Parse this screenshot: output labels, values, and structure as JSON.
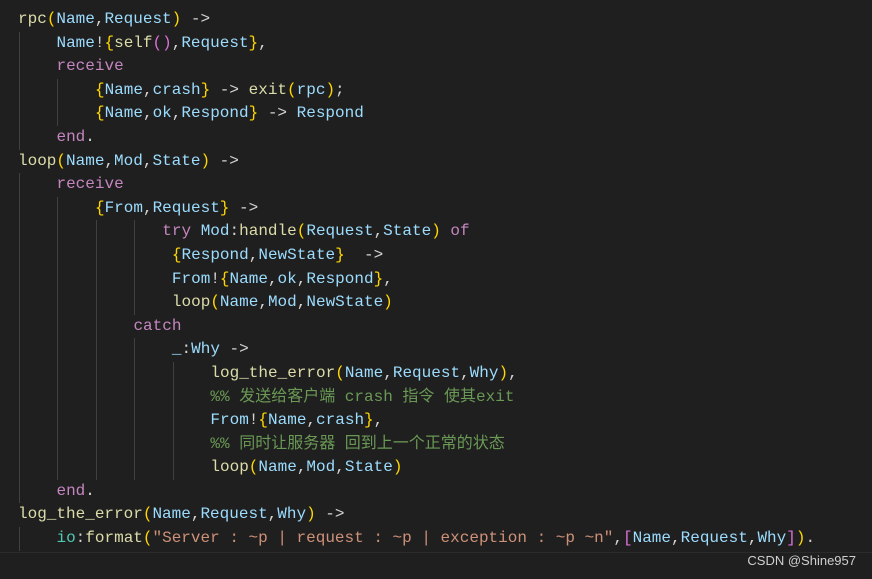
{
  "editor": {
    "background": "#1f1f1f",
    "lines": [
      {
        "indent": 0,
        "tokens": [
          [
            "rpc",
            "f"
          ],
          [
            "(",
            "b1"
          ],
          [
            "Name",
            "v"
          ],
          [
            ",",
            "p"
          ],
          [
            "Request",
            "v"
          ],
          [
            ")",
            "b1"
          ],
          [
            " ->",
            "p"
          ]
        ]
      },
      {
        "indent": 4,
        "tokens": [
          [
            "Name",
            "v"
          ],
          [
            "!",
            "p"
          ],
          [
            "{",
            "b1"
          ],
          [
            "self",
            "f"
          ],
          [
            "(",
            "b2"
          ],
          [
            ")",
            "b2"
          ],
          [
            ",",
            "p"
          ],
          [
            "Request",
            "v"
          ],
          [
            "}",
            "b1"
          ],
          [
            ",",
            "p"
          ]
        ]
      },
      {
        "indent": 4,
        "tokens": [
          [
            "receive",
            "k"
          ]
        ]
      },
      {
        "indent": 8,
        "tokens": [
          [
            "{",
            "b1"
          ],
          [
            "Name",
            "v"
          ],
          [
            ",",
            "p"
          ],
          [
            "crash",
            "v"
          ],
          [
            "}",
            "b1"
          ],
          [
            " -> ",
            "p"
          ],
          [
            "exit",
            "f"
          ],
          [
            "(",
            "b1"
          ],
          [
            "rpc",
            "v"
          ],
          [
            ")",
            "b1"
          ],
          [
            ";",
            "p"
          ]
        ]
      },
      {
        "indent": 8,
        "tokens": [
          [
            "{",
            "b1"
          ],
          [
            "Name",
            "v"
          ],
          [
            ",",
            "p"
          ],
          [
            "ok",
            "v"
          ],
          [
            ",",
            "p"
          ],
          [
            "Respond",
            "v"
          ],
          [
            "}",
            "b1"
          ],
          [
            " -> ",
            "p"
          ],
          [
            "Respond",
            "v"
          ]
        ]
      },
      {
        "indent": 4,
        "tokens": [
          [
            "end",
            "k"
          ],
          [
            ".",
            "p"
          ]
        ]
      },
      {
        "indent": 0,
        "tokens": [
          [
            "loop",
            "f"
          ],
          [
            "(",
            "b1"
          ],
          [
            "Name",
            "v"
          ],
          [
            ",",
            "p"
          ],
          [
            "Mod",
            "v"
          ],
          [
            ",",
            "p"
          ],
          [
            "State",
            "v"
          ],
          [
            ")",
            "b1"
          ],
          [
            " ->",
            "p"
          ]
        ]
      },
      {
        "indent": 4,
        "tokens": [
          [
            "receive",
            "k"
          ]
        ]
      },
      {
        "indent": 8,
        "tokens": [
          [
            "{",
            "b1"
          ],
          [
            "From",
            "v"
          ],
          [
            ",",
            "p"
          ],
          [
            "Request",
            "v"
          ],
          [
            "}",
            "b1"
          ],
          [
            " ->",
            "p"
          ]
        ]
      },
      {
        "indent": 15,
        "tokens": [
          [
            "try ",
            "k"
          ],
          [
            "Mod",
            "v"
          ],
          [
            ":",
            "p"
          ],
          [
            "handle",
            "f"
          ],
          [
            "(",
            "b1"
          ],
          [
            "Request",
            "v"
          ],
          [
            ",",
            "p"
          ],
          [
            "State",
            "v"
          ],
          [
            ")",
            "b1"
          ],
          [
            " of",
            "k"
          ]
        ]
      },
      {
        "indent": 16,
        "tokens": [
          [
            "{",
            "b1"
          ],
          [
            "Respond",
            "v"
          ],
          [
            ",",
            "p"
          ],
          [
            "NewState",
            "v"
          ],
          [
            "}",
            "b1"
          ],
          [
            "  ->",
            "p"
          ]
        ]
      },
      {
        "indent": 16,
        "tokens": [
          [
            "From",
            "v"
          ],
          [
            "!",
            "p"
          ],
          [
            "{",
            "b1"
          ],
          [
            "Name",
            "v"
          ],
          [
            ",",
            "p"
          ],
          [
            "ok",
            "v"
          ],
          [
            ",",
            "p"
          ],
          [
            "Respond",
            "v"
          ],
          [
            "}",
            "b1"
          ],
          [
            ",",
            "p"
          ]
        ]
      },
      {
        "indent": 16,
        "tokens": [
          [
            "loop",
            "f"
          ],
          [
            "(",
            "b1"
          ],
          [
            "Name",
            "v"
          ],
          [
            ",",
            "p"
          ],
          [
            "Mod",
            "v"
          ],
          [
            ",",
            "p"
          ],
          [
            "NewState",
            "v"
          ],
          [
            ")",
            "b1"
          ]
        ]
      },
      {
        "indent": 12,
        "tokens": [
          [
            "catch",
            "k"
          ]
        ]
      },
      {
        "indent": 16,
        "tokens": [
          [
            "_",
            "v"
          ],
          [
            ":",
            "p"
          ],
          [
            "Why",
            "v"
          ],
          [
            " ->",
            "p"
          ]
        ]
      },
      {
        "indent": 20,
        "tokens": [
          [
            "log_the_error",
            "f"
          ],
          [
            "(",
            "b1"
          ],
          [
            "Name",
            "v"
          ],
          [
            ",",
            "p"
          ],
          [
            "Request",
            "v"
          ],
          [
            ",",
            "p"
          ],
          [
            "Why",
            "v"
          ],
          [
            ")",
            "b1"
          ],
          [
            ",",
            "p"
          ]
        ]
      },
      {
        "indent": 20,
        "tokens": [
          [
            "%% 发送给客户端 crash 指令 使其exit",
            "c"
          ]
        ]
      },
      {
        "indent": 20,
        "tokens": [
          [
            "From",
            "v"
          ],
          [
            "!",
            "p"
          ],
          [
            "{",
            "b1"
          ],
          [
            "Name",
            "v"
          ],
          [
            ",",
            "p"
          ],
          [
            "crash",
            "v"
          ],
          [
            "}",
            "b1"
          ],
          [
            ",",
            "p"
          ]
        ]
      },
      {
        "indent": 20,
        "tokens": [
          [
            "%% 同时让服务器 回到上一个正常的状态",
            "c"
          ]
        ]
      },
      {
        "indent": 20,
        "tokens": [
          [
            "loop",
            "f"
          ],
          [
            "(",
            "b1"
          ],
          [
            "Name",
            "v"
          ],
          [
            ",",
            "p"
          ],
          [
            "Mod",
            "v"
          ],
          [
            ",",
            "p"
          ],
          [
            "State",
            "v"
          ],
          [
            ")",
            "b1"
          ]
        ]
      },
      {
        "indent": 4,
        "tokens": [
          [
            "end",
            "k"
          ],
          [
            ".",
            "p"
          ]
        ]
      },
      {
        "indent": 0,
        "tokens": [
          [
            "log_the_error",
            "f"
          ],
          [
            "(",
            "b1"
          ],
          [
            "Name",
            "v"
          ],
          [
            ",",
            "p"
          ],
          [
            "Request",
            "v"
          ],
          [
            ",",
            "p"
          ],
          [
            "Why",
            "v"
          ],
          [
            ")",
            "b1"
          ],
          [
            " ->",
            "p"
          ]
        ]
      },
      {
        "indent": 4,
        "tokens": [
          [
            "io",
            "m"
          ],
          [
            ":",
            "p"
          ],
          [
            "format",
            "f"
          ],
          [
            "(",
            "b1"
          ],
          [
            "\"Server : ~p | request : ~p | exception : ~p ~n\"",
            "s"
          ],
          [
            ",",
            "p"
          ],
          [
            "[",
            "b2"
          ],
          [
            "Name",
            "v"
          ],
          [
            ",",
            "p"
          ],
          [
            "Request",
            "v"
          ],
          [
            ",",
            "p"
          ],
          [
            "Why",
            "v"
          ],
          [
            "]",
            "b2"
          ],
          [
            ")",
            "b1"
          ],
          [
            ".",
            "p"
          ]
        ]
      },
      {
        "indent": 0,
        "tokens": []
      }
    ]
  },
  "watermark": "CSDN @Shine957"
}
